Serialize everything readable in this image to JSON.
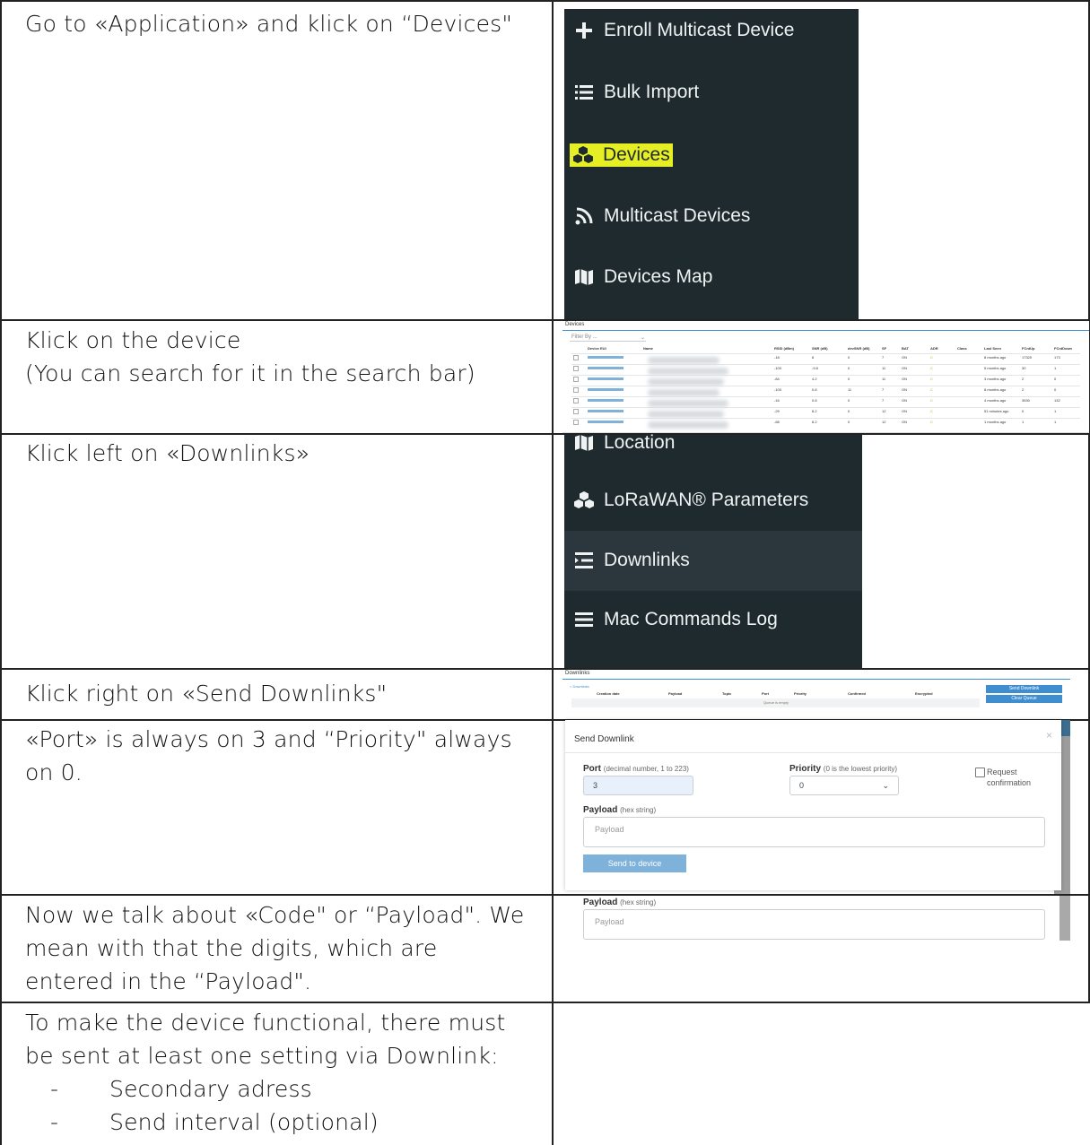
{
  "rows": [
    {
      "lines": [
        "Go to «Application» and klick on “Devices\""
      ]
    },
    {
      "lines": [
        "Klick on the device",
        "(You can search for it in the search bar)"
      ]
    },
    {
      "lines": [
        "Klick left on «Downlinks»"
      ]
    },
    {
      "lines": [
        "Klick right on «Send Downlinks\""
      ]
    },
    {
      "lines": [
        "«Port» is always on 3 and “Priority\" always",
        "on 0."
      ]
    },
    {
      "lines": [
        "Now we talk about «Code\" or “Payload\". We",
        "mean with that the digits, which are",
        "entered in the “Payload\"."
      ]
    },
    {
      "lines": [
        "To make the device functional, there must",
        "be sent at least one setting via Downlink:"
      ],
      "bullets": [
        "Secondary adress",
        "Send interval (optional)"
      ]
    }
  ],
  "menu1": {
    "items": [
      {
        "icon": "plus-icon",
        "label": "Enroll Multicast Device"
      },
      {
        "icon": "list-icon",
        "label": "Bulk Import"
      },
      {
        "icon": "cubes-icon",
        "label": "Devices"
      },
      {
        "icon": "rss-icon",
        "label": "Multicast Devices"
      },
      {
        "icon": "map-icon",
        "label": "Devices Map"
      }
    ],
    "highlight_color": "#e6ef24",
    "bg_color": "#1f2a2e"
  },
  "menu2": {
    "items": [
      {
        "icon": "map-icon",
        "label": "Location"
      },
      {
        "icon": "cubes-icon",
        "label": "LoRaWAN® Parameters"
      },
      {
        "icon": "indent-icon",
        "label": "Downlinks"
      },
      {
        "icon": "bars-icon",
        "label": "Mac Commands Log"
      }
    ]
  },
  "devices_shot": {
    "title": "Devices",
    "filter_placeholder": "Filter By ...",
    "columns": [
      "Device EUI",
      "Name",
      "RSSI (dBm)",
      "SNR (dB)",
      "devSNR (dB)",
      "SF",
      "BAT",
      "ADR",
      "Class",
      "Last Seen",
      "FCntUp",
      "FCntDown"
    ],
    "rows": [
      [
        "-18",
        "8",
        "0",
        "7",
        "ON",
        "C",
        "8 months ago",
        "17320",
        "173"
      ],
      [
        "-100",
        "-9.8",
        "0",
        "11",
        "ON",
        "C",
        "5 months ago",
        "30",
        "1"
      ],
      [
        "-84",
        "4.2",
        "0",
        "11",
        "ON",
        "C",
        "3 months ago",
        "2",
        "0"
      ],
      [
        "-100",
        "0.8",
        "11",
        "7",
        "ON",
        "C",
        "8 months ago",
        "2",
        "0"
      ],
      [
        "-16",
        "0.8",
        "0",
        "7",
        "ON",
        "C",
        "4 months ago",
        "3530",
        "132"
      ],
      [
        "-29",
        "8.2",
        "0",
        "12",
        "ON",
        "C",
        "51 minutes ago",
        "0",
        "1"
      ],
      [
        "-68",
        "8.2",
        "0",
        "12",
        "ON",
        "C",
        "1 months ago",
        "1",
        "1"
      ]
    ]
  },
  "downlinks_shot": {
    "title": "Downlinks",
    "sub": "< Downlinks",
    "columns": [
      "Creation date",
      "Payload",
      "Topic",
      "Port",
      "Priority",
      "Confirmed",
      "Encrypted"
    ],
    "empty": "Queue is empty",
    "send_button": "Send Downlink",
    "clear_button": "Clear Queue"
  },
  "send_modal": {
    "title": "Send Downlink",
    "close": "×",
    "port_label": "Port",
    "port_hint": "(decimal number, 1 to 223)",
    "port_value": "3",
    "priority_label": "Priority",
    "priority_hint": "(0 is the lowest priority)",
    "priority_value": "0",
    "confirm_label": "Request confirmation",
    "payload_label": "Payload",
    "payload_hint": "(hex string)",
    "payload_placeholder": "Payload",
    "send_button": "Send to device"
  }
}
